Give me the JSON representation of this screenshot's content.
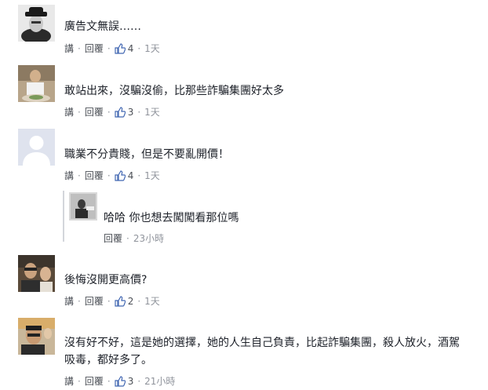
{
  "comments": [
    {
      "text": "廣告文無誤……",
      "actions": {
        "reply_word": "講",
        "reply": "回覆",
        "likes": "4",
        "time": "1天"
      }
    },
    {
      "text": "敢站出來，沒騙沒偷，比那些詐騙集團好太多",
      "actions": {
        "reply_word": "講",
        "reply": "回覆",
        "likes": "3",
        "time": "1天"
      }
    },
    {
      "text": "職業不分貴賤，但是不要亂開價！",
      "actions": {
        "reply_word": "講",
        "reply": "回覆",
        "likes": "4",
        "time": "1天"
      }
    },
    {
      "text": "後悔沒開更高價?",
      "actions": {
        "reply_word": "講",
        "reply": "回覆",
        "likes": "2",
        "time": "1天"
      }
    },
    {
      "text_line1": "沒有好不好，這是她的選擇，她的人生自己負責，比起詐騙集團，殺人放火，酒駕",
      "text_line2": "吸毒，都好多了。",
      "actions": {
        "reply_word": "講",
        "reply": "回覆",
        "likes": "3",
        "time": "21小時"
      }
    }
  ],
  "reply": {
    "text": "哈哈 你也想去闖闖看那位嗎",
    "actions": {
      "reply": "回覆",
      "time": "23小時"
    }
  },
  "colors": {
    "text": "#1d2129",
    "action": "#4b4f56",
    "meta": "#90949c",
    "like_blue": "#4267b2"
  }
}
